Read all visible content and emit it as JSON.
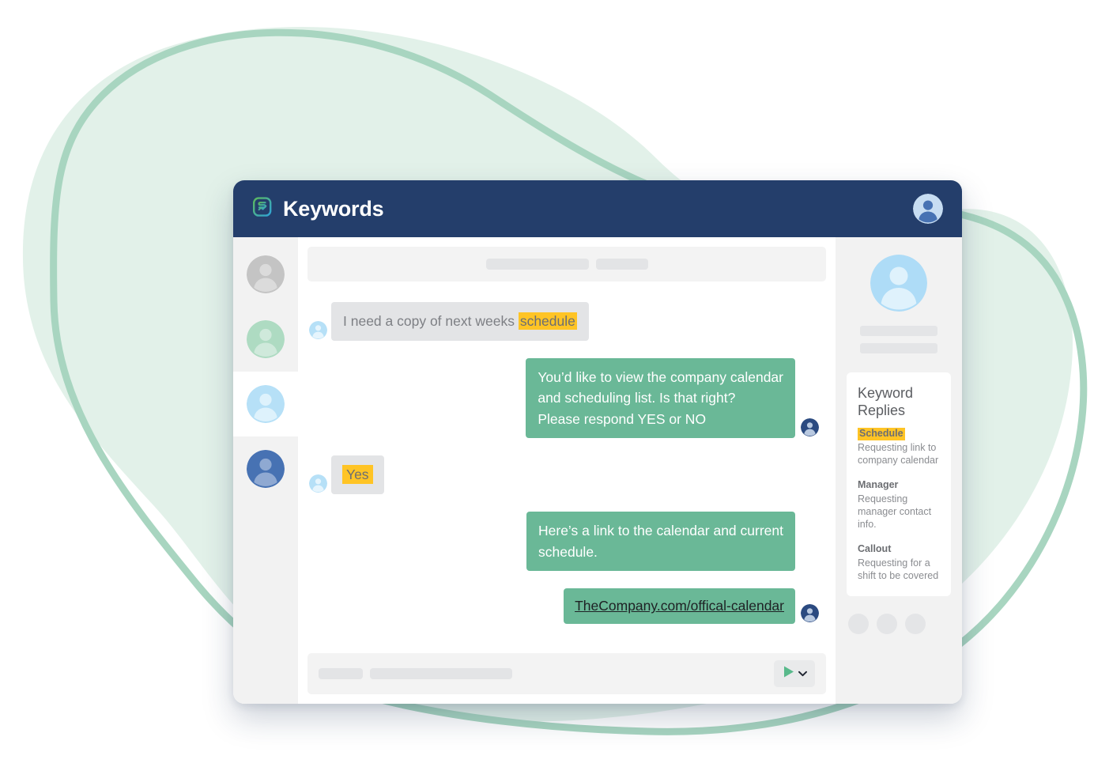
{
  "window": {
    "title": "Keywords",
    "logo_icon": "keywords-speech-bubble-logo-icon",
    "account_avatar_icon": "user-avatar-icon"
  },
  "colors": {
    "header_blue": "#243E6B",
    "bubble_green": "#6AB897",
    "bubble_gray": "#E3E4E6",
    "keyword_highlight_yellow": "#FFC425",
    "background_blob_fill": "#E2F1E9",
    "background_blob_stroke": "#A8D5C0",
    "panel_gray": "#F2F2F2"
  },
  "conversation_rail": {
    "items": [
      {
        "name": "conversation-1",
        "avatar_color": "#C4C4C4",
        "active": false
      },
      {
        "name": "conversation-2",
        "avatar_color": "#AEDBC2",
        "active": false
      },
      {
        "name": "conversation-3",
        "avatar_color": "#B6E0F7",
        "active": true
      },
      {
        "name": "conversation-4",
        "avatar_color": "#4772B3",
        "active": false
      }
    ]
  },
  "chat_header": {
    "placeholder_1": "",
    "placeholder_2": ""
  },
  "messages": [
    {
      "id": "msg-1",
      "direction": "incoming",
      "avatar_icon": "contact-avatar-icon",
      "text_before": "I need a copy of next weeks ",
      "highlight": "schedule",
      "text_after": ""
    },
    {
      "id": "msg-2",
      "direction": "outgoing",
      "avatar_icon": "agent-avatar-icon",
      "line_1": "You’d like to view the company calendar",
      "line_2": "and scheduling list. Is that right?",
      "line_3": "Please respond YES or NO"
    },
    {
      "id": "msg-3",
      "direction": "incoming",
      "avatar_icon": "contact-avatar-icon",
      "highlight": "Yes"
    },
    {
      "id": "msg-4",
      "direction": "outgoing",
      "line_1": "Here’s a link to the calendar and current",
      "line_2": "schedule."
    },
    {
      "id": "msg-5",
      "direction": "outgoing",
      "avatar_icon": "agent-avatar-icon",
      "link_text": "TheCompany.com/offical-calendar"
    }
  ],
  "composer": {
    "placeholder_1": "",
    "placeholder_2": "",
    "send_icon": "send-play-icon",
    "dropdown_icon": "chevron-down-icon"
  },
  "detail_panel": {
    "contact_avatar_icon": "contact-large-avatar-icon",
    "skeleton_1": "",
    "skeleton_2": "",
    "keyword_card": {
      "title_line_1": "Keyword",
      "title_line_2": "Replies",
      "entries": [
        {
          "name": "Schedule",
          "highlighted": true,
          "description_line_1": "Requesting link to",
          "description_line_2": "company calendar"
        },
        {
          "name": "Manager",
          "highlighted": false,
          "description_line_1": "Requesting",
          "description_line_2": "manager contact",
          "description_line_3": "info."
        },
        {
          "name": "Callout",
          "highlighted": false,
          "description_line_1": "Requesting for a",
          "description_line_2": "shift to be covered"
        }
      ]
    },
    "dots": [
      "dot-1",
      "dot-2",
      "dot-3"
    ]
  }
}
